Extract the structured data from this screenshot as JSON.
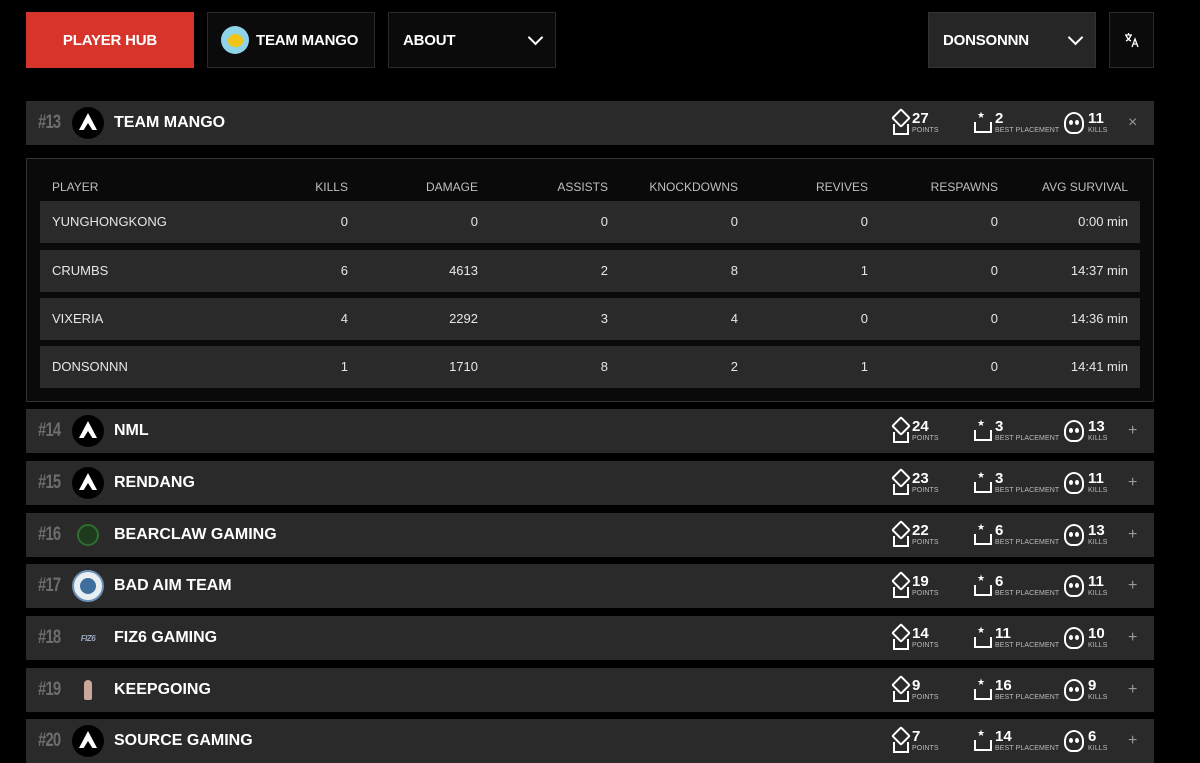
{
  "nav": {
    "player_hub": "PLAYER HUB",
    "team": "TEAM MANGO",
    "about": "ABOUT",
    "user": "DONSONNN"
  },
  "labels": {
    "points": "POINTS",
    "best_placement": "BEST PLACEMENT",
    "kills": "KILLS"
  },
  "table_headers": [
    "PLAYER",
    "KILLS",
    "DAMAGE",
    "ASSISTS",
    "KNOCKDOWNS",
    "REVIVES",
    "RESPAWNS",
    "AVG SURVIVAL"
  ],
  "expanded_team": {
    "rank": "#13",
    "name": "TEAM MANGO",
    "logo": "apex-icon",
    "points": "27",
    "best_placement": "2",
    "kills": "11",
    "toggle": "×",
    "players": [
      {
        "player": "YUNGHONGKONG",
        "kills": "0",
        "damage": "0",
        "assists": "0",
        "knockdowns": "0",
        "revives": "0",
        "respawns": "0",
        "avg_survival": "0:00 min"
      },
      {
        "player": "CRUMBS",
        "kills": "6",
        "damage": "4613",
        "assists": "2",
        "knockdowns": "8",
        "revives": "1",
        "respawns": "0",
        "avg_survival": "14:37 min"
      },
      {
        "player": "VIXERIA",
        "kills": "4",
        "damage": "2292",
        "assists": "3",
        "knockdowns": "4",
        "revives": "0",
        "respawns": "0",
        "avg_survival": "14:36 min"
      },
      {
        "player": "DONSONNN",
        "kills": "1",
        "damage": "1710",
        "assists": "8",
        "knockdowns": "2",
        "revives": "1",
        "respawns": "0",
        "avg_survival": "14:41 min"
      }
    ]
  },
  "teams": [
    {
      "rank": "#14",
      "name": "NML",
      "logo": "apex-icon",
      "points": "24",
      "best_placement": "3",
      "kills": "13",
      "toggle": "+"
    },
    {
      "rank": "#15",
      "name": "RENDANG",
      "logo": "apex-icon",
      "points": "23",
      "best_placement": "3",
      "kills": "11",
      "toggle": "+"
    },
    {
      "rank": "#16",
      "name": "BEARCLAW GAMING",
      "logo": "bearclaw-logo",
      "points": "22",
      "best_placement": "6",
      "kills": "13",
      "toggle": "+"
    },
    {
      "rank": "#17",
      "name": "BAD AIM TEAM",
      "logo": "bad-aim-logo",
      "points": "19",
      "best_placement": "6",
      "kills": "11",
      "toggle": "+"
    },
    {
      "rank": "#18",
      "name": "FIZ6 GAMING",
      "logo": "fiz6-logo",
      "points": "14",
      "best_placement": "11",
      "kills": "10",
      "toggle": "+"
    },
    {
      "rank": "#19",
      "name": "KEEPGOING",
      "logo": "keepgoing-logo",
      "points": "9",
      "best_placement": "16",
      "kills": "9",
      "toggle": "+"
    },
    {
      "rank": "#20",
      "name": "SOURCE GAMING",
      "logo": "apex-icon",
      "points": "7",
      "best_placement": "14",
      "kills": "6",
      "toggle": "+"
    }
  ],
  "colors": {
    "accent": "#d7352b",
    "row_bg": "#2a2a2a",
    "page_bg": "#000000"
  }
}
